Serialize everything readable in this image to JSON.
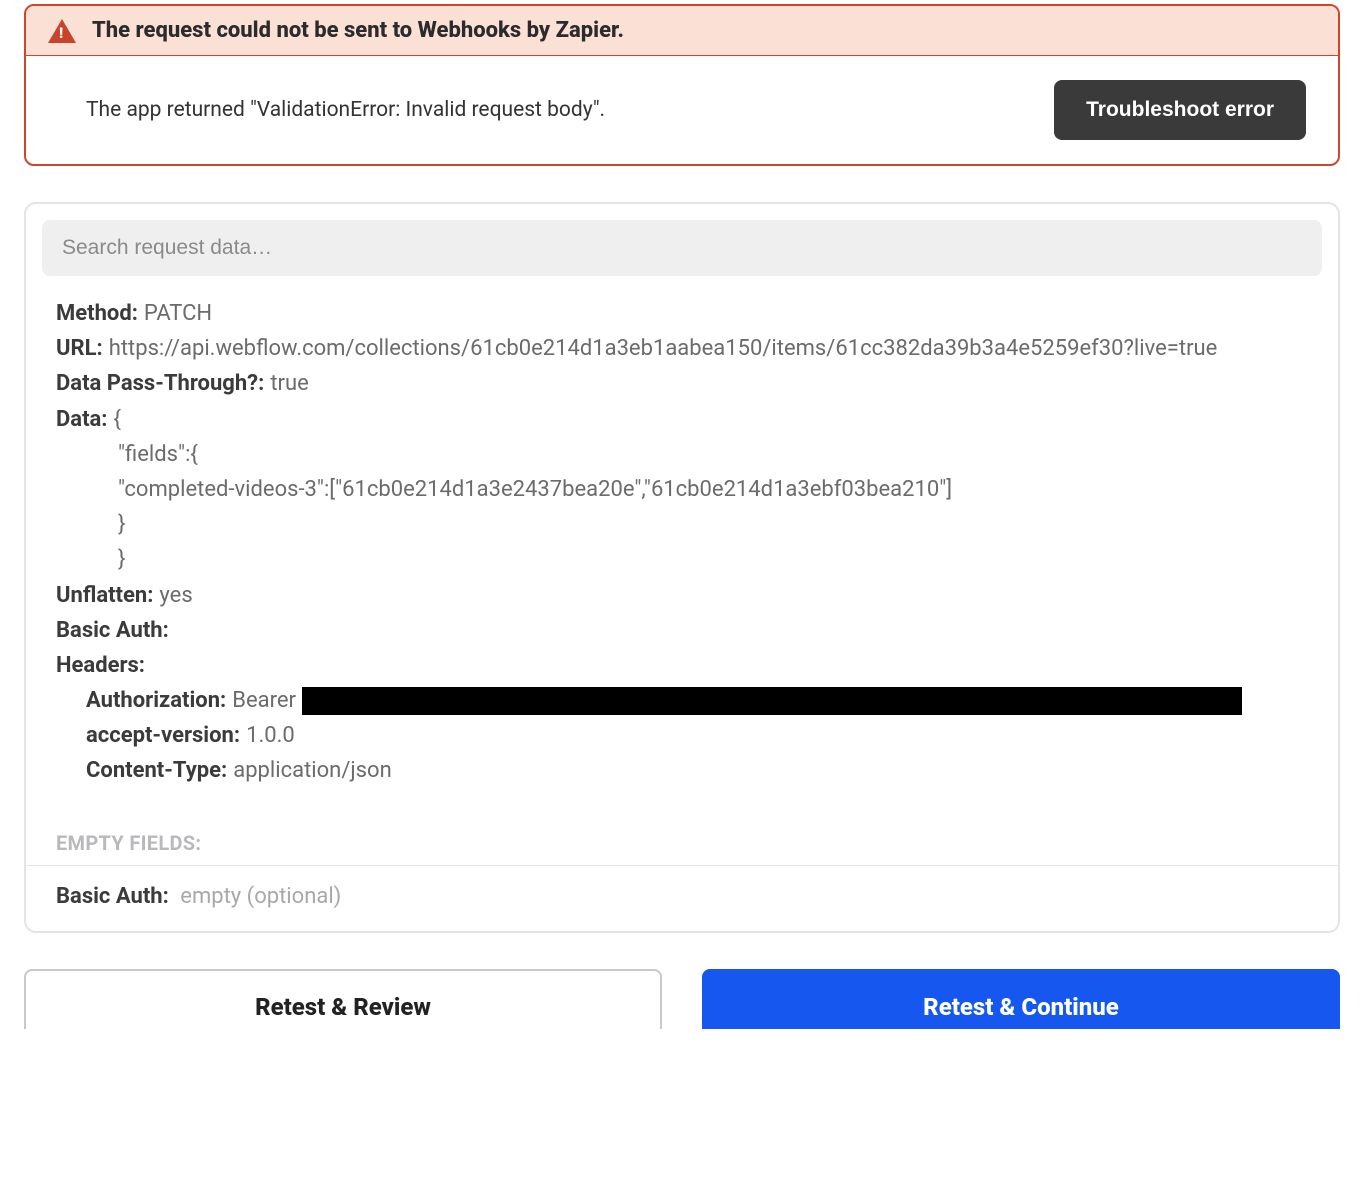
{
  "error": {
    "title": "The request could not be sent to Webhooks by Zapier.",
    "detail": "The app returned \"ValidationError: Invalid request body\".",
    "troubleshoot_label": "Troubleshoot error"
  },
  "search": {
    "placeholder": "Search request data…"
  },
  "req": {
    "method_label": "Method:",
    "method_value": "PATCH",
    "url_label": "URL:",
    "url_value": "https://api.webflow.com/collections/61cb0e214d1a3eb1aabea150/items/61cc382da39b3a4e5259ef30?live=true",
    "pass_label": "Data Pass-Through?:",
    "pass_value": "true",
    "data_label": "Data:",
    "data_open": "{",
    "data_l2": "\"fields\":{",
    "data_l3": "\"completed-videos-3\":[\"61cb0e214d1a3e2437bea20e\",\"61cb0e214d1a3ebf03bea210\"]",
    "data_l4": "}",
    "data_l5": "}",
    "unflatten_label": "Unflatten:",
    "unflatten_value": "yes",
    "basic_auth_label": "Basic Auth:",
    "headers_label": "Headers:",
    "hdr_auth_label": "Authorization:",
    "hdr_auth_value": "Bearer ",
    "hdr_accept_label": "accept-version:",
    "hdr_accept_value": "1.0.0",
    "hdr_ct_label": "Content-Type:",
    "hdr_ct_value": "application/json"
  },
  "empty_fields_label": "EMPTY FIELDS:",
  "basic_auth_row": {
    "label": "Basic Auth:",
    "value": "empty (optional)"
  },
  "footer": {
    "review_label": "Retest & Review",
    "continue_label": "Retest & Continue"
  }
}
